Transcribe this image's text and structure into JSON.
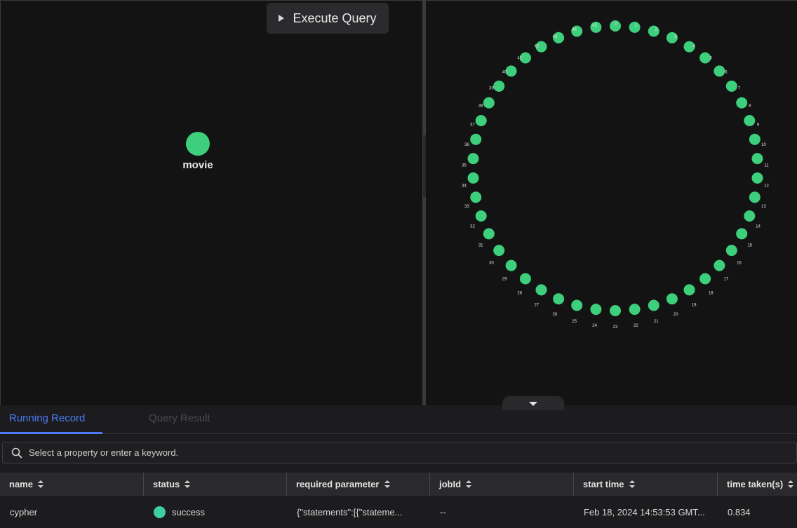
{
  "toolbar": {
    "execute_label": "Execute Query"
  },
  "schema_graph": {
    "node_label": "movie",
    "node_color": "#3ecf7c"
  },
  "result_graph": {
    "node_color": "#3ecf7c",
    "node_labels": [
      "0",
      "1",
      "2",
      "3",
      "4",
      "5",
      "6",
      "7",
      "8",
      "9",
      "10",
      "11",
      "12",
      "13",
      "14",
      "15",
      "16",
      "17",
      "18",
      "19",
      "20",
      "21",
      "22",
      "23",
      "24",
      "25",
      "26",
      "27",
      "28",
      "29",
      "30",
      "31",
      "32",
      "33",
      "34",
      "35",
      "36",
      "37",
      "38",
      "39",
      "40",
      "41",
      "42",
      "43",
      "44",
      "45"
    ]
  },
  "bottom_panel": {
    "tabs": [
      {
        "label": "Running Record",
        "active": true
      },
      {
        "label": "Query Result",
        "active": false
      }
    ],
    "search": {
      "placeholder": "Select a property or enter a keyword."
    },
    "columns": [
      "name",
      "status",
      "required parameter",
      "jobId",
      "start time",
      "time taken(s)"
    ],
    "rows": [
      {
        "name": "cypher",
        "status": "success",
        "required_parameter": "{\"statements\":[{\"stateme...",
        "jobId": "--",
        "start_time": "Feb 18, 2024 14:53:53 GMT...",
        "time_taken": "0.834"
      }
    ]
  },
  "colors": {
    "accent": "#4b7bf5",
    "success": "#3ecfa0",
    "node": "#3ecf7c"
  }
}
